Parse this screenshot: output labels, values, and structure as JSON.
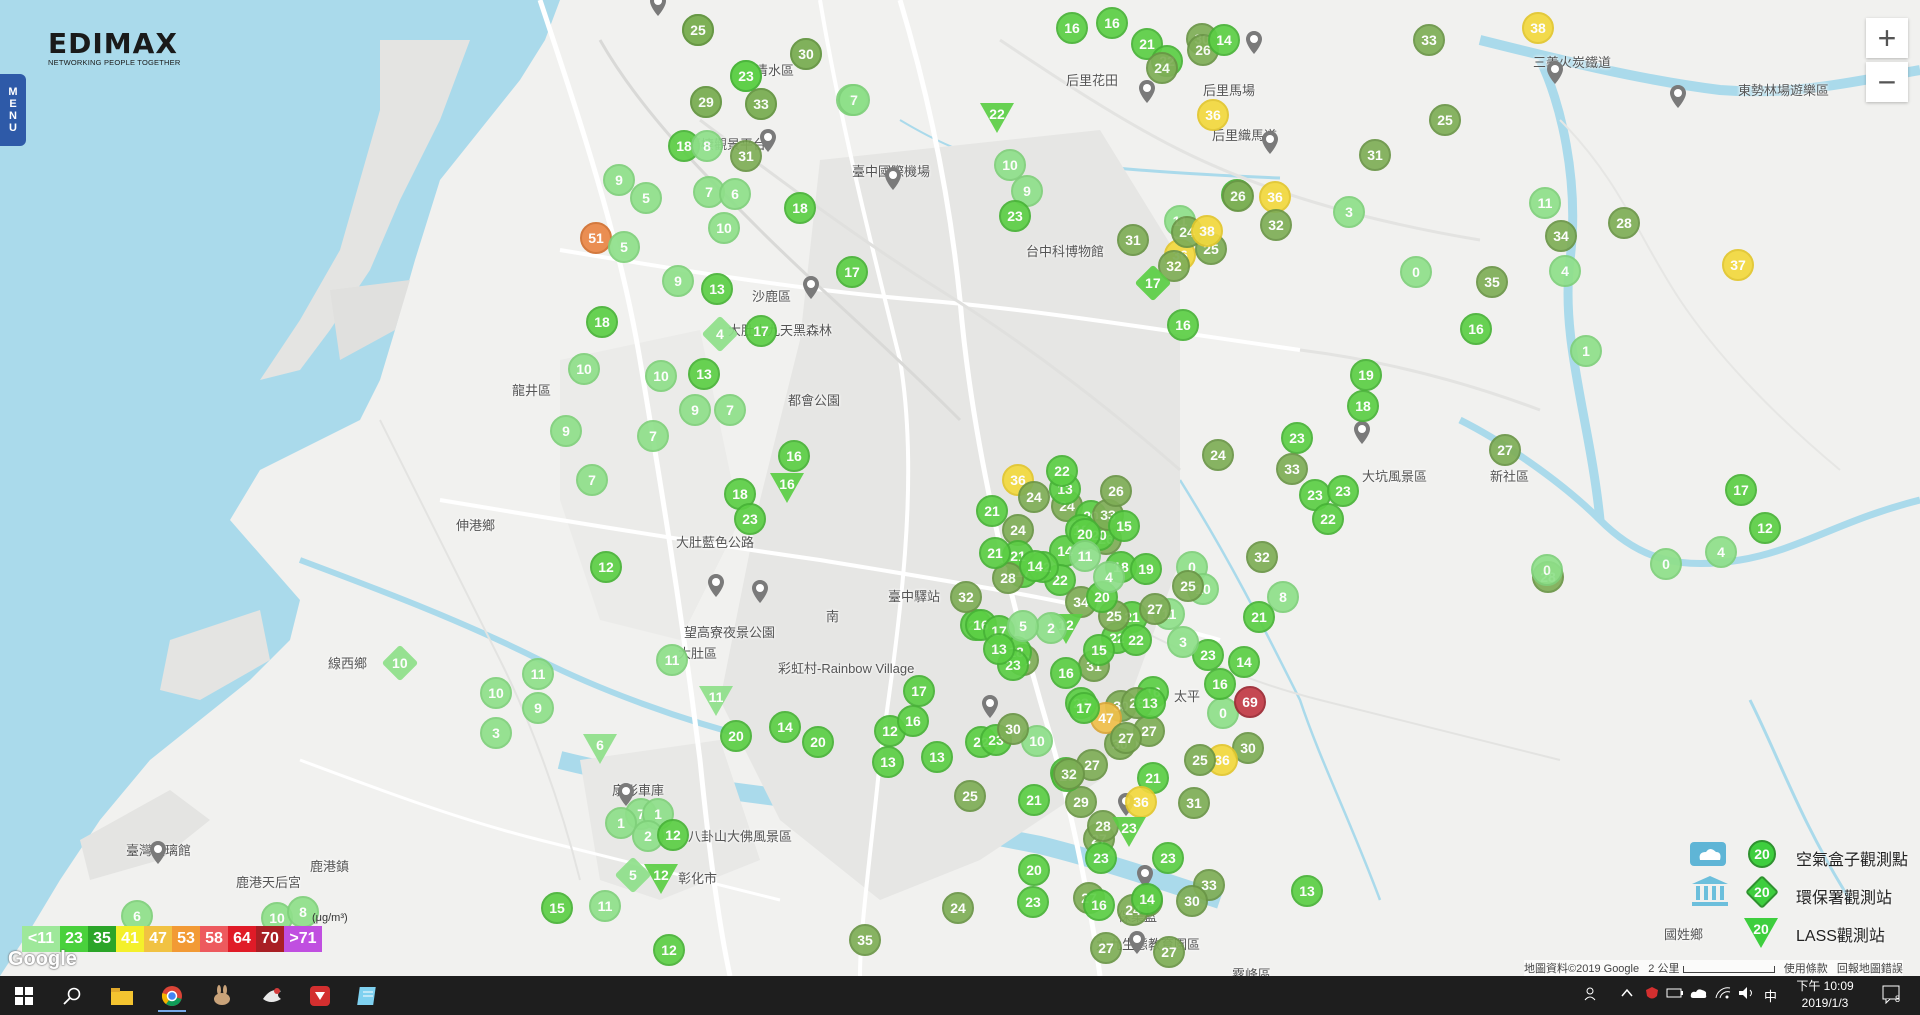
{
  "brand": {
    "name": "EDIMAX",
    "tagline": "NETWORKING PEOPLE TOGETHER"
  },
  "menu_label": "MENU",
  "zoom": {
    "in": "+",
    "out": "−"
  },
  "colors": {
    "water": "#aadaeb",
    "land": "#f1f1ef",
    "level_lt11": "#9ee89a",
    "level_23": "#49d13c",
    "level_35": "#2ba528",
    "level_41": "#f4f02b",
    "level_47": "#f1c242",
    "level_53": "#f29a35",
    "level_58": "#ed5a5e",
    "level_64": "#e01b27",
    "level_70": "#a91f24",
    "level_gt71": "#c04fe0"
  },
  "legend_scale": {
    "unit": "(μg/m³)",
    "levels": [
      {
        "label": "<11",
        "color": "#9ee89a"
      },
      {
        "label": "23",
        "color": "#49d13c"
      },
      {
        "label": "35",
        "color": "#2ba528"
      },
      {
        "label": "41",
        "color": "#f4f02b"
      },
      {
        "label": "47",
        "color": "#f1c242"
      },
      {
        "label": "53",
        "color": "#f29a35"
      },
      {
        "label": "58",
        "color": "#ed5a5e"
      },
      {
        "label": "64",
        "color": "#e01b27"
      },
      {
        "label": "70",
        "color": "#a91f24"
      },
      {
        "label": ">71",
        "color": "#c04fe0"
      }
    ]
  },
  "legend_types": [
    {
      "icon": "circle",
      "value": "20",
      "label": "空氣盒子觀測點",
      "badge": "cloud-icon"
    },
    {
      "icon": "diamond",
      "value": "20",
      "label": "環保署觀測站",
      "badge": "government-building-icon"
    },
    {
      "icon": "triangle",
      "value": "20",
      "label": "LASS觀測站",
      "badge": ""
    }
  ],
  "google_logo": "Google",
  "attribution": {
    "data": "地圖資料©2019 Google",
    "scale": "2 公里",
    "terms": "使用條款",
    "report": "回報地圖錯誤"
  },
  "place_labels": [
    "清水區",
    "梧棲觀景平台",
    "臺中國際機場",
    "后里花田",
    "后里馬場",
    "后里織馬道",
    "三義火炭鐵道",
    "東勢林場遊樂區",
    "沙鹿區",
    "大肚山九天黑森林",
    "龍井區",
    "都會公園",
    "伸港鄉",
    "大肚藍色公路",
    "望高寮夜景公園",
    "彩虹村-Rainbow Village",
    "大肚區",
    "線西鄉",
    "扇形車庫",
    "八卦山大佛風景區",
    "彰化市",
    "臺灣玻璃館",
    "鹿港鎮",
    "鹿港天后宮",
    "大坑風景區",
    "新社區",
    "台中科博物館",
    "保集藍",
    "九九生態教育園區",
    "霧峰區",
    "國姓鄉",
    "南",
    "太平",
    "臺中驛站"
  ],
  "stations": [
    {
      "v": 16,
      "t": "c"
    },
    {
      "v": 10,
      "t": "c"
    },
    {
      "v": 10,
      "t": "c"
    },
    {
      "v": 9,
      "t": "c"
    },
    {
      "v": 9,
      "t": "c"
    },
    {
      "v": 7,
      "t": "c"
    },
    {
      "v": 18,
      "t": "c"
    },
    {
      "v": 8,
      "t": "c"
    },
    {
      "v": 31,
      "t": "c"
    },
    {
      "v": 9,
      "t": "c"
    },
    {
      "v": 5,
      "t": "c"
    },
    {
      "v": 7,
      "t": "c"
    },
    {
      "v": 6,
      "t": "c"
    },
    {
      "v": 18,
      "t": "c"
    },
    {
      "v": 10,
      "t": "c"
    },
    {
      "v": 51,
      "t": "c"
    },
    {
      "v": 5,
      "t": "c"
    },
    {
      "v": 9,
      "t": "c"
    },
    {
      "v": 13,
      "t": "c"
    },
    {
      "v": 17,
      "t": "c"
    },
    {
      "v": 18,
      "t": "c"
    },
    {
      "v": 4,
      "t": "d"
    },
    {
      "v": 17,
      "t": "c"
    },
    {
      "v": 10,
      "t": "c"
    },
    {
      "v": 10,
      "t": "c"
    },
    {
      "v": 13,
      "t": "c"
    },
    {
      "v": 9,
      "t": "c"
    },
    {
      "v": 7,
      "t": "c"
    },
    {
      "v": 9,
      "t": "c"
    },
    {
      "v": 7,
      "t": "c"
    },
    {
      "v": 7,
      "t": "c"
    },
    {
      "v": 18,
      "t": "c"
    },
    {
      "v": 23,
      "t": "c"
    },
    {
      "v": 16,
      "t": "c"
    },
    {
      "v": 16,
      "t": "tri"
    },
    {
      "v": 12,
      "t": "c"
    },
    {
      "v": 11,
      "t": "c"
    },
    {
      "v": 10,
      "t": "d"
    },
    {
      "v": 11,
      "t": "c"
    },
    {
      "v": 10,
      "t": "c"
    },
    {
      "v": 9,
      "t": "c"
    },
    {
      "v": 3,
      "t": "c"
    },
    {
      "v": 11,
      "t": "tri"
    },
    {
      "v": 20,
      "t": "c"
    },
    {
      "v": 6,
      "t": "tri"
    },
    {
      "v": 14,
      "t": "c"
    },
    {
      "v": 20,
      "t": "c"
    },
    {
      "v": 12,
      "t": "c"
    },
    {
      "v": 13,
      "t": "c"
    },
    {
      "v": 13,
      "t": "c"
    },
    {
      "v": 16,
      "t": "c"
    },
    {
      "v": 17,
      "t": "c"
    },
    {
      "v": 25,
      "t": "c"
    },
    {
      "v": 7,
      "t": "c"
    },
    {
      "v": 1,
      "t": "c"
    },
    {
      "v": 1,
      "t": "c"
    },
    {
      "v": 2,
      "t": "c"
    },
    {
      "v": 12,
      "t": "c"
    },
    {
      "v": 12,
      "t": "tri"
    },
    {
      "v": 5,
      "t": "d"
    },
    {
      "v": 11,
      "t": "c"
    },
    {
      "v": 15,
      "t": "c"
    },
    {
      "v": 6,
      "t": "c"
    },
    {
      "v": 10,
      "t": "c"
    },
    {
      "v": 8,
      "t": "c"
    },
    {
      "v": 12,
      "t": "c"
    },
    {
      "v": 35,
      "t": "c"
    },
    {
      "v": 24,
      "t": "c"
    },
    {
      "v": 20,
      "t": "c"
    },
    {
      "v": 27,
      "t": "c"
    },
    {
      "v": 27,
      "t": "c"
    },
    {
      "v": 14,
      "t": "c"
    },
    {
      "v": 23,
      "t": "c"
    },
    {
      "v": 22,
      "t": "tri"
    },
    {
      "v": 7,
      "t": "c"
    },
    {
      "v": 10,
      "t": "c"
    },
    {
      "v": 9,
      "t": "c"
    },
    {
      "v": 23,
      "t": "c"
    },
    {
      "v": 16,
      "t": "c"
    },
    {
      "v": 16,
      "t": "c"
    },
    {
      "v": 21,
      "t": "c"
    },
    {
      "v": 22,
      "t": "c"
    },
    {
      "v": 30,
      "t": "c"
    },
    {
      "v": 24,
      "t": "c"
    },
    {
      "v": 26,
      "t": "c"
    },
    {
      "v": 14,
      "t": "c"
    },
    {
      "v": 36,
      "t": "c"
    },
    {
      "v": 22,
      "t": "c"
    },
    {
      "v": 11,
      "t": "c"
    },
    {
      "v": 31,
      "t": "c"
    },
    {
      "v": 36,
      "t": "c"
    },
    {
      "v": 25,
      "t": "c"
    },
    {
      "v": 32,
      "t": "c"
    },
    {
      "v": 24,
      "t": "c"
    },
    {
      "v": 26,
      "t": "c"
    },
    {
      "v": 36,
      "t": "c"
    },
    {
      "v": 38,
      "t": "c"
    },
    {
      "v": 17,
      "t": "d"
    },
    {
      "v": 32,
      "t": "c"
    },
    {
      "v": 33,
      "t": "c"
    },
    {
      "v": 38,
      "t": "c"
    },
    {
      "v": 25,
      "t": "c"
    },
    {
      "v": 31,
      "t": "c"
    },
    {
      "v": 11,
      "t": "c"
    },
    {
      "v": 34,
      "t": "c"
    },
    {
      "v": 28,
      "t": "c"
    },
    {
      "v": 3,
      "t": "c"
    },
    {
      "v": 4,
      "t": "c"
    },
    {
      "v": 35,
      "t": "c"
    },
    {
      "v": 37,
      "t": "c"
    },
    {
      "v": 0,
      "t": "c"
    },
    {
      "v": 16,
      "t": "c"
    },
    {
      "v": 1,
      "t": "c"
    },
    {
      "v": 19,
      "t": "c"
    },
    {
      "v": 16,
      "t": "c"
    },
    {
      "v": 23,
      "t": "c"
    },
    {
      "v": 18,
      "t": "c"
    },
    {
      "v": 23,
      "t": "c"
    },
    {
      "v": 27,
      "t": "c"
    },
    {
      "v": 33,
      "t": "c"
    },
    {
      "v": 24,
      "t": "c"
    },
    {
      "v": 32,
      "t": "c"
    },
    {
      "v": 8,
      "t": "c"
    },
    {
      "v": 23,
      "t": "c"
    },
    {
      "v": 22,
      "t": "c"
    },
    {
      "v": 28,
      "t": "c"
    },
    {
      "v": 17,
      "t": "c"
    },
    {
      "v": 12,
      "t": "c"
    },
    {
      "v": 4,
      "t": "c"
    },
    {
      "v": 0,
      "t": "c"
    },
    {
      "v": 0,
      "t": "c"
    },
    {
      "v": 0,
      "t": "c"
    },
    {
      "v": 0,
      "t": "c"
    },
    {
      "v": 69,
      "t": "c"
    },
    {
      "v": 30,
      "t": "c"
    },
    {
      "v": 36,
      "t": "c"
    },
    {
      "v": 25,
      "t": "c"
    },
    {
      "v": 23,
      "t": "c"
    },
    {
      "v": 14,
      "t": "c"
    },
    {
      "v": 21,
      "t": "c"
    },
    {
      "v": 16,
      "t": "c"
    },
    {
      "v": 13,
      "t": "c"
    },
    {
      "v": 33,
      "t": "c"
    },
    {
      "v": 30,
      "t": "c"
    },
    {
      "v": 26,
      "t": "c"
    },
    {
      "v": 23,
      "t": "c"
    },
    {
      "v": 27,
      "t": "c"
    },
    {
      "v": 24,
      "t": "c"
    },
    {
      "v": 27,
      "t": "c"
    },
    {
      "v": 14,
      "t": "c"
    },
    {
      "v": 23,
      "t": "c"
    },
    {
      "v": 29,
      "t": "c"
    },
    {
      "v": 21,
      "t": "c"
    },
    {
      "v": 20,
      "t": "c"
    },
    {
      "v": 28,
      "t": "c"
    },
    {
      "v": 16,
      "t": "c"
    },
    {
      "v": 31,
      "t": "c"
    },
    {
      "v": 30,
      "t": "c"
    },
    {
      "v": 30,
      "t": "c"
    },
    {
      "v": 27,
      "t": "c"
    },
    {
      "v": 32,
      "t": "c"
    },
    {
      "v": 47,
      "t": "c"
    },
    {
      "v": 27,
      "t": "c"
    },
    {
      "v": 16,
      "t": "c"
    },
    {
      "v": 21,
      "t": "c"
    },
    {
      "v": 31,
      "t": "c"
    },
    {
      "v": 22,
      "t": "c"
    },
    {
      "v": 18,
      "t": "c"
    },
    {
      "v": 14,
      "t": "c"
    },
    {
      "v": 24,
      "t": "c"
    },
    {
      "v": 21,
      "t": "c"
    },
    {
      "v": 36,
      "t": "c"
    },
    {
      "v": 24,
      "t": "c"
    },
    {
      "v": 17,
      "t": "c"
    },
    {
      "v": 13,
      "t": "c"
    },
    {
      "v": 24,
      "t": "c"
    },
    {
      "v": 28,
      "t": "c"
    },
    {
      "v": 22,
      "t": "c"
    },
    {
      "v": 34,
      "t": "c"
    },
    {
      "v": 25,
      "t": "c"
    },
    {
      "v": 22,
      "t": "c"
    },
    {
      "v": 20,
      "t": "c"
    },
    {
      "v": 15,
      "t": "c"
    },
    {
      "v": 21,
      "t": "c"
    },
    {
      "v": 23,
      "t": "c"
    },
    {
      "v": 28,
      "t": "c"
    },
    {
      "v": 22,
      "t": "c"
    },
    {
      "v": 12,
      "t": "tri"
    },
    {
      "v": 16,
      "t": "c"
    },
    {
      "v": 17,
      "t": "c"
    },
    {
      "v": 18,
      "t": "c"
    },
    {
      "v": 14,
      "t": "c"
    },
    {
      "v": 21,
      "t": "c"
    },
    {
      "v": 22,
      "t": "c"
    },
    {
      "v": 23,
      "t": "c"
    },
    {
      "v": 10,
      "t": "c"
    },
    {
      "v": 30,
      "t": "c"
    },
    {
      "v": 23,
      "t": "c"
    },
    {
      "v": 21,
      "t": "c"
    },
    {
      "v": 32,
      "t": "c"
    },
    {
      "v": 16,
      "t": "c"
    },
    {
      "v": 17,
      "t": "c"
    },
    {
      "v": 13,
      "t": "c"
    },
    {
      "v": 2,
      "t": "c"
    },
    {
      "v": 3,
      "t": "c"
    },
    {
      "v": 5,
      "t": "c"
    },
    {
      "v": 10,
      "t": "c"
    },
    {
      "v": 11,
      "t": "c"
    },
    {
      "v": 26,
      "t": "c"
    },
    {
      "v": 20,
      "t": "c"
    },
    {
      "v": 18,
      "t": "c"
    },
    {
      "v": 20,
      "t": "c"
    },
    {
      "v": 19,
      "t": "c"
    },
    {
      "v": 25,
      "t": "c"
    },
    {
      "v": 33,
      "t": "c"
    },
    {
      "v": 27,
      "t": "c"
    },
    {
      "v": 26,
      "t": "c"
    },
    {
      "v": 22,
      "t": "c"
    },
    {
      "v": 20,
      "t": "c"
    },
    {
      "v": 11,
      "t": "c"
    },
    {
      "v": 4,
      "t": "c"
    },
    {
      "v": 15,
      "t": "c"
    },
    {
      "v": 28,
      "t": "c"
    },
    {
      "v": 21,
      "t": "c"
    },
    {
      "v": 27,
      "t": "c"
    },
    {
      "v": 13,
      "t": "c"
    },
    {
      "v": 36,
      "t": "c"
    },
    {
      "v": 23,
      "t": "tri"
    },
    {
      "v": 25,
      "t": "c"
    },
    {
      "v": 30,
      "t": "c"
    },
    {
      "v": 23,
      "t": "c"
    },
    {
      "v": 29,
      "t": "c"
    },
    {
      "v": 33,
      "t": "c"
    }
  ],
  "taskbar": {
    "clock_time": "下午 10:09",
    "clock_date": "2019/1/3",
    "ime": "中",
    "notifications": "8",
    "apps": [
      "windows-start-icon",
      "search-icon",
      "file-explorer-icon",
      "chrome-icon",
      "app-rabbit-icon",
      "app-wing-icon",
      "app-red-icon",
      "app-notes-icon"
    ]
  }
}
